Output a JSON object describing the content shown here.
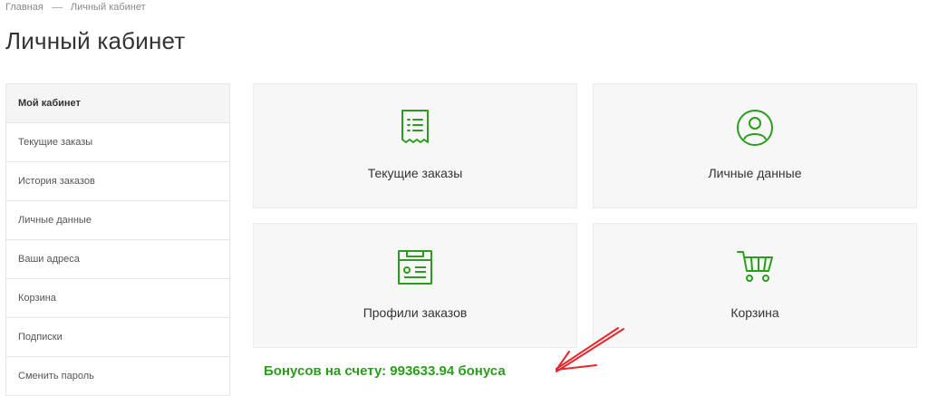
{
  "breadcrumb": {
    "home": "Главная",
    "current": "Личный кабинет"
  },
  "page": {
    "title": "Личный кабинет"
  },
  "sidebar": {
    "items": [
      {
        "label": "Мой кабинет",
        "active": true
      },
      {
        "label": "Текущие заказы"
      },
      {
        "label": "История заказов"
      },
      {
        "label": "Личные данные"
      },
      {
        "label": "Ваши адреса"
      },
      {
        "label": "Корзина"
      },
      {
        "label": "Подписки"
      },
      {
        "label": "Сменить пароль"
      }
    ]
  },
  "cards": [
    {
      "label": "Текущие заказы",
      "icon": "receipt-icon"
    },
    {
      "label": "Личные данные",
      "icon": "user-icon"
    },
    {
      "label": "Профили заказов",
      "icon": "profile-form-icon"
    },
    {
      "label": "Корзина",
      "icon": "cart-icon"
    }
  ],
  "bonus": {
    "text": "Бонусов на счету: 993633.94 бонуса"
  },
  "colors": {
    "accent": "#2a9d1d",
    "arrow": "#e8262a"
  }
}
